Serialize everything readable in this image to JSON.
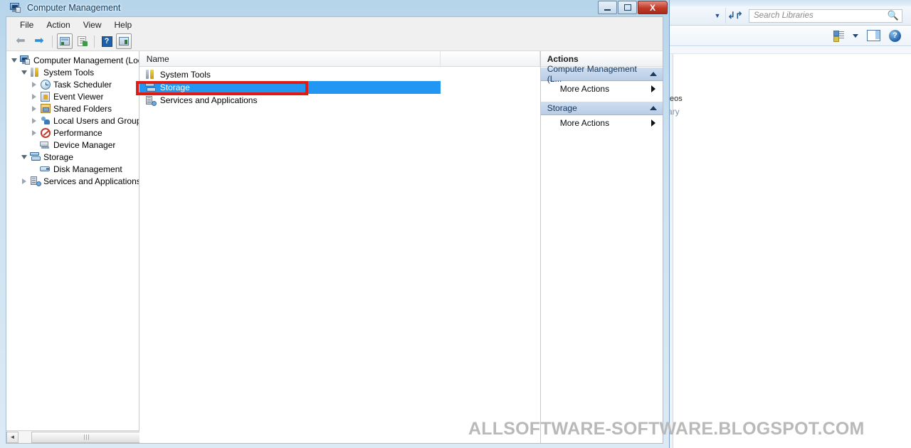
{
  "background_window": {
    "search": {
      "placeholder": "Search Libraries",
      "icon": "magnifier-icon"
    },
    "refresh_icon": "refresh-icon",
    "dropdown_icon": "chevron-down-icon",
    "view_icon": "view-options-icon",
    "view_caret_icon": "chevron-down-icon",
    "preview_pane_icon": "preview-pane-icon",
    "help_icon": "help-icon",
    "partial_text_1": "eos",
    "partial_text_2": "ary"
  },
  "window": {
    "title": "Computer Management",
    "icon": "computer-management-icon",
    "controls": {
      "minimize": "–",
      "maximize": "□",
      "close": "X"
    }
  },
  "menubar": {
    "items": [
      {
        "label": "File"
      },
      {
        "label": "Action"
      },
      {
        "label": "View"
      },
      {
        "label": "Help"
      }
    ]
  },
  "toolbar": {
    "buttons": [
      {
        "name": "back-button",
        "icon": "back-arrow-icon"
      },
      {
        "name": "forward-button",
        "icon": "forward-arrow-icon"
      },
      {
        "name": "show-console-tree-button",
        "icon": "console-tree-icon"
      },
      {
        "name": "export-list-button",
        "icon": "export-list-icon"
      },
      {
        "name": "help-button",
        "icon": "help-question-icon"
      },
      {
        "name": "show-action-pane-button",
        "icon": "action-pane-icon"
      }
    ]
  },
  "tree": {
    "nodes": [
      {
        "label": "Computer Management (Local",
        "depth": 0,
        "expander": "expanded",
        "icon": "computer-management-icon",
        "selected": false
      },
      {
        "label": "System Tools",
        "depth": 1,
        "expander": "expanded",
        "icon": "system-tools-icon",
        "selected": false
      },
      {
        "label": "Task Scheduler",
        "depth": 2,
        "expander": "collapsed",
        "icon": "task-scheduler-icon",
        "selected": false
      },
      {
        "label": "Event Viewer",
        "depth": 2,
        "expander": "collapsed",
        "icon": "event-viewer-icon",
        "selected": false
      },
      {
        "label": "Shared Folders",
        "depth": 2,
        "expander": "collapsed",
        "icon": "shared-folders-icon",
        "selected": false
      },
      {
        "label": "Local Users and Groups",
        "depth": 2,
        "expander": "collapsed",
        "icon": "local-users-icon",
        "selected": false
      },
      {
        "label": "Performance",
        "depth": 2,
        "expander": "collapsed",
        "icon": "performance-icon",
        "selected": false
      },
      {
        "label": "Device Manager",
        "depth": 2,
        "expander": "none",
        "icon": "device-manager-icon",
        "selected": false
      },
      {
        "label": "Storage",
        "depth": 1,
        "expander": "expanded",
        "icon": "storage-icon",
        "selected": false
      },
      {
        "label": "Disk Management",
        "depth": 2,
        "expander": "none",
        "icon": "disk-management-icon",
        "selected": false
      },
      {
        "label": "Services and Applications",
        "depth": 1,
        "expander": "collapsed",
        "icon": "services-applications-icon",
        "selected": false
      }
    ],
    "scrollbar": {
      "left_arrow": "◄",
      "right_arrow": "►",
      "thumb_grip": "|||"
    }
  },
  "list": {
    "columns": [
      "Name",
      ""
    ],
    "rows": [
      {
        "label": "System Tools",
        "icon": "system-tools-icon",
        "selected": false
      },
      {
        "label": "Storage",
        "icon": "storage-icon",
        "selected": true
      },
      {
        "label": "Services and Applications",
        "icon": "services-applications-icon",
        "selected": false
      }
    ]
  },
  "actions": {
    "title": "Actions",
    "groups": [
      {
        "header": "Computer Management (L...",
        "collapse_icon": "chevron-up-icon",
        "items": [
          {
            "label": "More Actions",
            "submenu_icon": "submenu-arrow-icon"
          }
        ]
      },
      {
        "header": "Storage",
        "collapse_icon": "chevron-up-icon",
        "items": [
          {
            "label": "More Actions",
            "submenu_icon": "submenu-arrow-icon"
          }
        ]
      }
    ]
  },
  "annotation": {
    "type": "red-rectangle",
    "color": "#e01b13"
  },
  "watermark": {
    "text": "ALLSOFTWARE-SOFTWARE.BLOGSPOT.COM",
    "color": "#b9b9b9"
  }
}
